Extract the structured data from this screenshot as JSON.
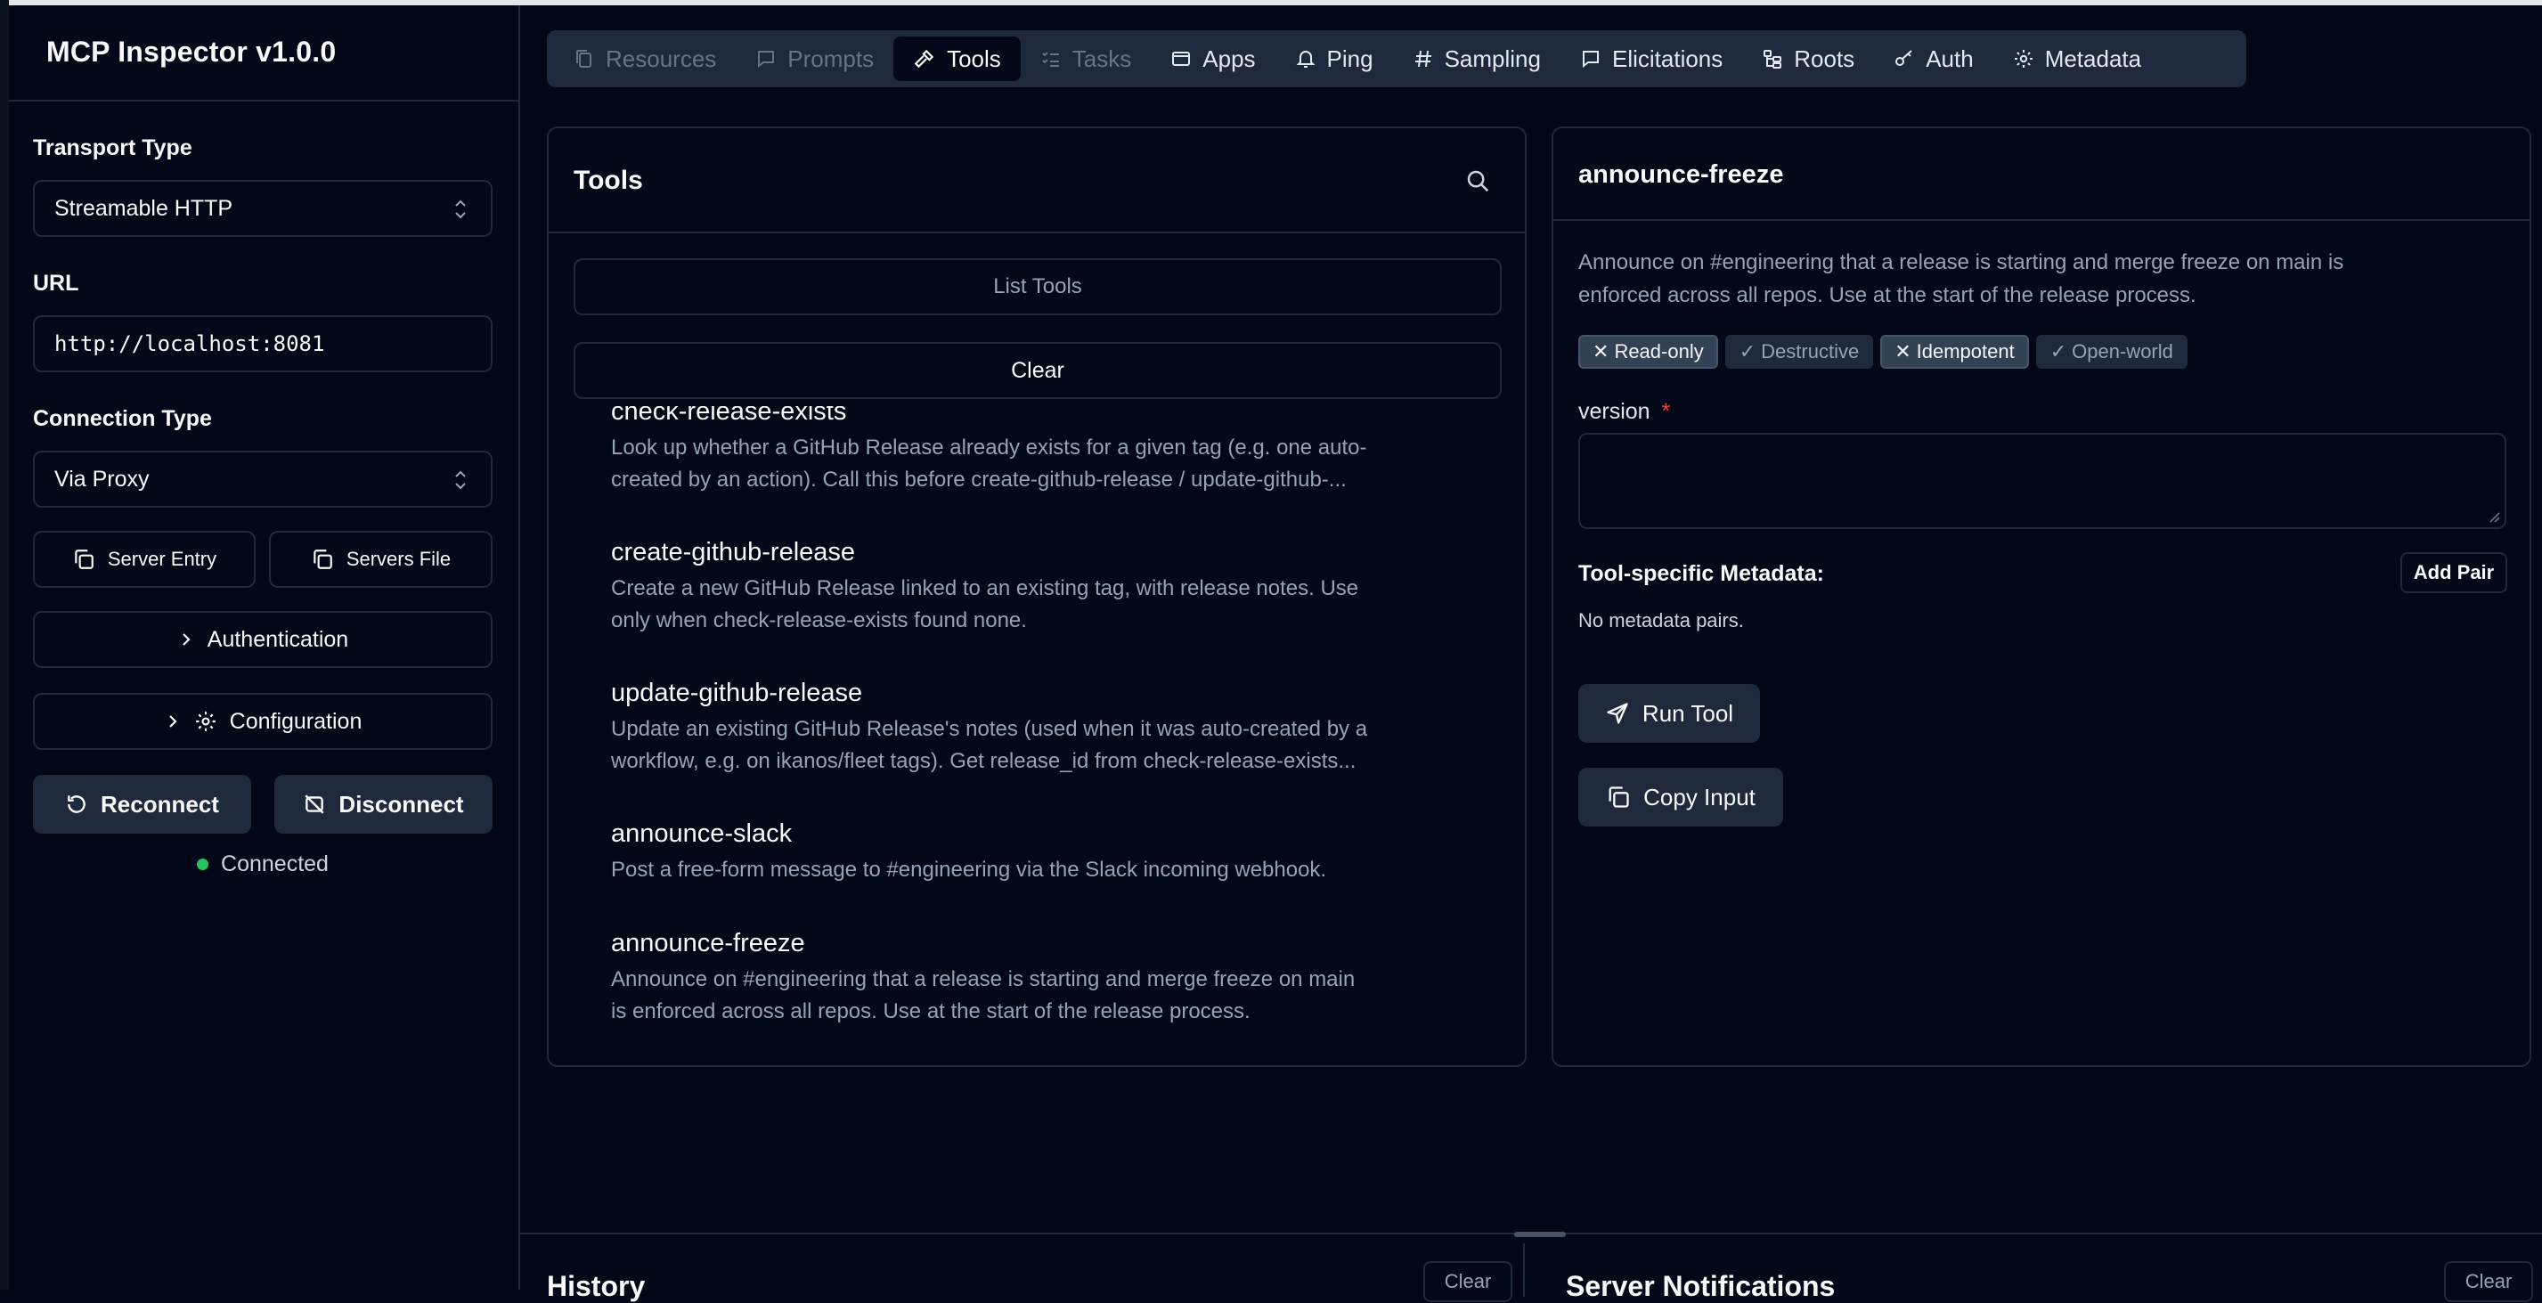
{
  "app": {
    "title": "MCP Inspector v1.0.0"
  },
  "sidebar": {
    "transport_label": "Transport Type",
    "transport_value": "Streamable HTTP",
    "url_label": "URL",
    "url_value": "http://localhost:8081",
    "connection_label": "Connection Type",
    "connection_value": "Via Proxy",
    "server_entry": "Server Entry",
    "servers_file": "Servers File",
    "authentication": "Authentication",
    "configuration": "Configuration",
    "reconnect": "Reconnect",
    "disconnect": "Disconnect",
    "status": "Connected"
  },
  "tabs": [
    {
      "label": "Resources",
      "state": "disabled",
      "icon": "document-copy-icon"
    },
    {
      "label": "Prompts",
      "state": "disabled",
      "icon": "message-square-icon"
    },
    {
      "label": "Tools",
      "state": "active",
      "icon": "hammer-icon"
    },
    {
      "label": "Tasks",
      "state": "disabled",
      "icon": "list-checks-icon"
    },
    {
      "label": "Apps",
      "state": "normal",
      "icon": "app-window-icon"
    },
    {
      "label": "Ping",
      "state": "normal",
      "icon": "bell-icon"
    },
    {
      "label": "Sampling",
      "state": "normal",
      "icon": "hash-icon"
    },
    {
      "label": "Elicitations",
      "state": "normal",
      "icon": "message-square-icon"
    },
    {
      "label": "Roots",
      "state": "normal",
      "icon": "folder-tree-icon"
    },
    {
      "label": "Auth",
      "state": "normal",
      "icon": "key-icon"
    },
    {
      "label": "Metadata",
      "state": "normal",
      "icon": "gear-icon"
    }
  ],
  "tools_panel": {
    "title": "Tools",
    "list_button": "List Tools",
    "clear_button": "Clear",
    "items": [
      {
        "name": "check-release-exists",
        "desc1": "Look up whether a GitHub Release already exists for a given tag (e.g. one auto-",
        "desc2": "created by an action). Call this before create-github-release / update-github-..."
      },
      {
        "name": "create-github-release",
        "desc1": "Create a new GitHub Release linked to an existing tag, with release notes. Use",
        "desc2": "only when check-release-exists found none."
      },
      {
        "name": "update-github-release",
        "desc1": "Update an existing GitHub Release's notes (used when it was auto-created by a",
        "desc2": "workflow, e.g. on ikanos/fleet tags). Get release_id from check-release-exists..."
      },
      {
        "name": "announce-slack",
        "desc1": "Post a free-form message to #engineering via the Slack incoming webhook.",
        "desc2": ""
      },
      {
        "name": "announce-freeze",
        "desc1": "Announce on #engineering that a release is starting and merge freeze on main",
        "desc2": "is enforced across all repos. Use at the start of the release process."
      }
    ]
  },
  "detail_panel": {
    "title": "announce-freeze",
    "desc1": "Announce on #engineering that a release is starting and merge freeze on main is",
    "desc2": "enforced across all repos. Use at the start of the release process.",
    "badges": [
      {
        "mark": "✕",
        "label": "Read-only",
        "on": true
      },
      {
        "mark": "✓",
        "label": "Destructive",
        "on": false
      },
      {
        "mark": "✕",
        "label": "Idempotent",
        "on": true
      },
      {
        "mark": "✓",
        "label": "Open-world",
        "on": false
      }
    ],
    "param_label": "version",
    "param_required": "*",
    "param_value": "",
    "metadata_label": "Tool-specific Metadata:",
    "add_pair": "Add Pair",
    "no_metadata": "No metadata pairs.",
    "run_tool": "Run Tool",
    "copy_input": "Copy Input"
  },
  "bottom": {
    "history_title": "History",
    "history_clear": "Clear",
    "notifications_title": "Server Notifications",
    "notifications_clear": "Clear"
  },
  "colors": {
    "background": "#020817",
    "border": "#1e293b",
    "muted_text": "#94a3b8",
    "status_ok": "#22c55e",
    "required": "#ef4444"
  }
}
